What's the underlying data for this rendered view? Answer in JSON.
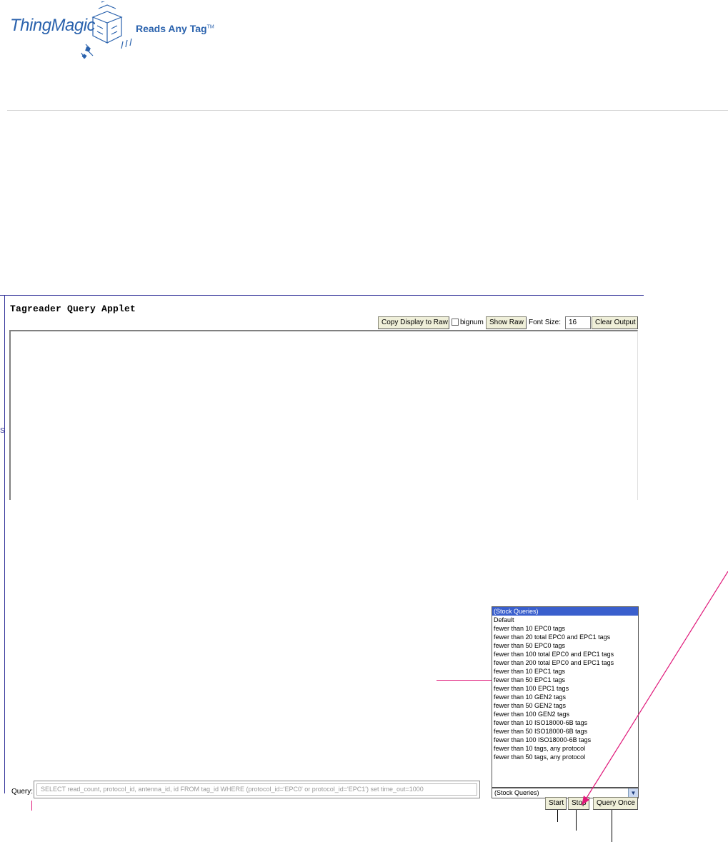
{
  "branding": {
    "logo_text": "ThingMagic",
    "tagline": "Reads Any Tag",
    "tagline_tm": "TM"
  },
  "applet": {
    "title": "Tagreader Query Applet",
    "left_glyph": "S"
  },
  "toolbar": {
    "copy_display_to_raw": "Copy Display to Raw",
    "bignum_label": "bignum",
    "show_raw": "Show Raw",
    "font_size_label": "Font Size:",
    "font_size_value": "16",
    "clear_output": "Clear Output"
  },
  "stock_queries": {
    "selected": "(Stock Queries)",
    "options": [
      "(Stock Queries)",
      "Default",
      "fewer than 10 EPC0 tags",
      "fewer than 20 total EPC0 and EPC1 tags",
      "fewer than 50 EPC0 tags",
      "fewer than 100 total EPC0 and EPC1 tags",
      "fewer than 200 total EPC0 and EPC1 tags",
      "fewer than 10 EPC1 tags",
      "fewer than 50 EPC1 tags",
      "fewer than 100 EPC1 tags",
      "fewer than 10 GEN2 tags",
      "fewer than 50 GEN2 tags",
      "fewer than 100 GEN2 tags",
      "fewer than 10 ISO18000-6B tags",
      "fewer than 50 ISO18000-6B tags",
      "fewer than 100 ISO18000-6B tags",
      "fewer than 10 tags, any protocol",
      "fewer than 50 tags, any protocol"
    ]
  },
  "query": {
    "label": "Query:",
    "value": "SELECT read_count, protocol_id, antenna_id, id FROM tag_id WHERE (protocol_id='EPC0' or protocol_id='EPC1') set time_out=1000"
  },
  "actions": {
    "start": "Start",
    "stop": "Stop",
    "query_once": "Query Once"
  },
  "colors": {
    "brand_blue": "#2a62ad",
    "frame_blue": "#333399",
    "callout_pink": "#e0187a",
    "list_selected": "#3a5fcd",
    "button_face": "#efefd9"
  }
}
